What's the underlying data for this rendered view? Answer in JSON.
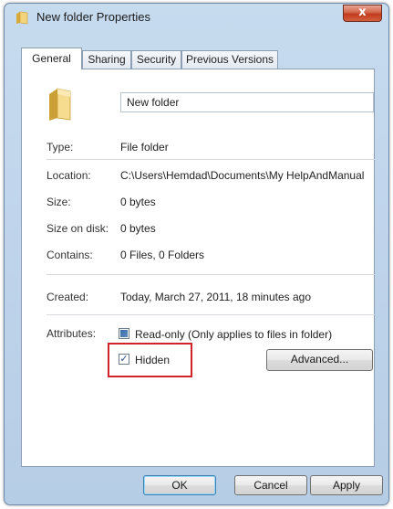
{
  "window": {
    "title": "New folder Properties",
    "close_label": "x"
  },
  "tabs": [
    {
      "label": "General",
      "active": true
    },
    {
      "label": "Sharing",
      "active": false
    },
    {
      "label": "Security",
      "active": false
    },
    {
      "label": "Previous Versions",
      "active": false
    }
  ],
  "general": {
    "folder_name": "New folder",
    "fields": {
      "type": {
        "label": "Type:",
        "value": "File folder"
      },
      "location": {
        "label": "Location:",
        "value": "C:\\Users\\Hemdad\\Documents\\My HelpAndManual"
      },
      "size": {
        "label": "Size:",
        "value": "0 bytes"
      },
      "size_on_disk": {
        "label": "Size on disk:",
        "value": "0 bytes"
      },
      "contains": {
        "label": "Contains:",
        "value": "0 Files, 0 Folders"
      },
      "created": {
        "label": "Created:",
        "value": "Today, March 27, 2011, 18 minutes ago"
      }
    },
    "attributes": {
      "label": "Attributes:",
      "read_only": {
        "label": "Read-only (Only applies to files in folder)",
        "state": "indeterminate"
      },
      "hidden": {
        "label": "Hidden",
        "state": "checked"
      },
      "advanced_label": "Advanced..."
    }
  },
  "footer": {
    "ok_label": "OK",
    "cancel_label": "Cancel",
    "apply_label": "Apply"
  },
  "icons": {
    "title": "folder-icon",
    "large": "folder-icon",
    "check": "✓"
  },
  "colors": {
    "highlight": "#d2232a",
    "titlebar": "#c7dbef",
    "close": "#c23a1b"
  }
}
